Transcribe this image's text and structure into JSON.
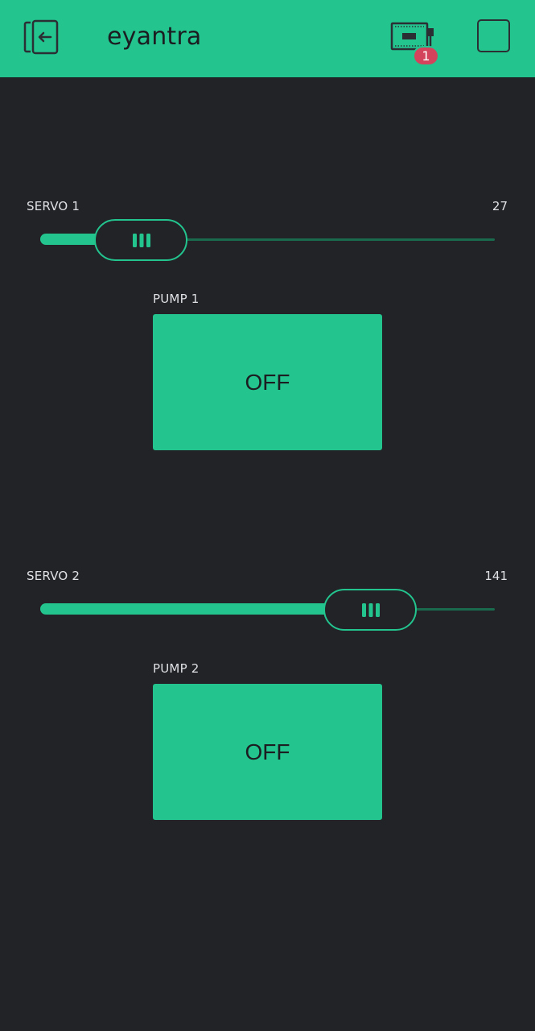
{
  "app": {
    "title": "eyantra",
    "notification_count": "1"
  },
  "colors": {
    "accent": "#23c48e",
    "background": "#212327",
    "badge": "#d3435c"
  },
  "widgets": {
    "servo1": {
      "label": "SERVO 1",
      "value": "27",
      "min": 0,
      "max": 180
    },
    "pump1": {
      "label": "PUMP 1",
      "state": "OFF"
    },
    "servo2": {
      "label": "SERVO 2",
      "value": "141",
      "min": 0,
      "max": 180
    },
    "pump2": {
      "label": "PUMP 2",
      "state": "OFF"
    }
  },
  "icons": {
    "back": "back-to-projects-icon",
    "device": "device-hardware-icon",
    "mode": "stop-square-icon"
  }
}
